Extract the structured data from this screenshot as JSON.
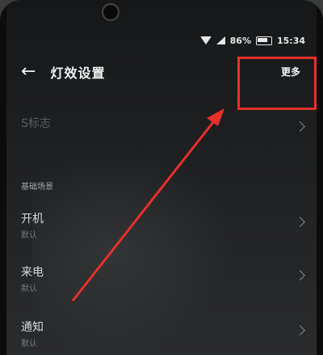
{
  "status_bar": {
    "battery": "86%",
    "time": "15:34"
  },
  "app_bar": {
    "title": "灯效设置",
    "back_icon": "arrow-left-icon",
    "more_label": "更多"
  },
  "rows": [
    {
      "label": "S标志",
      "sub": ""
    },
    {
      "label": "开机",
      "sub": "默认"
    },
    {
      "label": "来电",
      "sub": "默认"
    },
    {
      "label": "通知",
      "sub": "默认"
    }
  ],
  "section": {
    "label": "基础场景"
  },
  "colors": {
    "annotation": "#e8302a",
    "text": "#f2f2f2",
    "background": "#1c1d1f"
  }
}
